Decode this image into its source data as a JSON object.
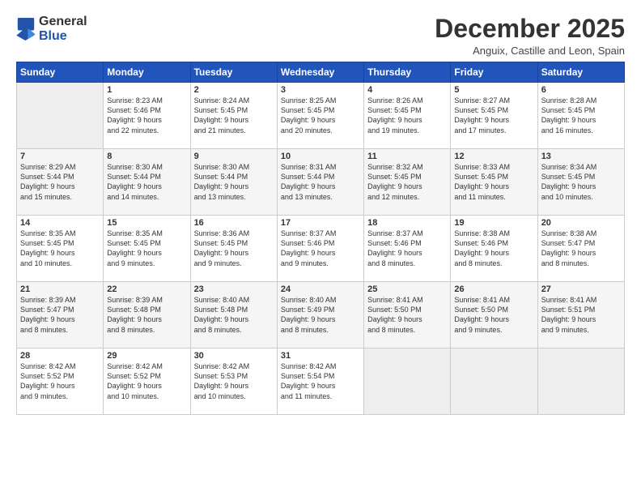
{
  "header": {
    "logo": {
      "general": "General",
      "blue": "Blue"
    },
    "title": "December 2025",
    "subtitle": "Anguix, Castille and Leon, Spain"
  },
  "weekdays": [
    "Sunday",
    "Monday",
    "Tuesday",
    "Wednesday",
    "Thursday",
    "Friday",
    "Saturday"
  ],
  "weeks": [
    [
      {
        "day": "",
        "info": ""
      },
      {
        "day": "1",
        "info": "Sunrise: 8:23 AM\nSunset: 5:46 PM\nDaylight: 9 hours\nand 22 minutes."
      },
      {
        "day": "2",
        "info": "Sunrise: 8:24 AM\nSunset: 5:45 PM\nDaylight: 9 hours\nand 21 minutes."
      },
      {
        "day": "3",
        "info": "Sunrise: 8:25 AM\nSunset: 5:45 PM\nDaylight: 9 hours\nand 20 minutes."
      },
      {
        "day": "4",
        "info": "Sunrise: 8:26 AM\nSunset: 5:45 PM\nDaylight: 9 hours\nand 19 minutes."
      },
      {
        "day": "5",
        "info": "Sunrise: 8:27 AM\nSunset: 5:45 PM\nDaylight: 9 hours\nand 17 minutes."
      },
      {
        "day": "6",
        "info": "Sunrise: 8:28 AM\nSunset: 5:45 PM\nDaylight: 9 hours\nand 16 minutes."
      }
    ],
    [
      {
        "day": "7",
        "info": "Sunrise: 8:29 AM\nSunset: 5:44 PM\nDaylight: 9 hours\nand 15 minutes."
      },
      {
        "day": "8",
        "info": "Sunrise: 8:30 AM\nSunset: 5:44 PM\nDaylight: 9 hours\nand 14 minutes."
      },
      {
        "day": "9",
        "info": "Sunrise: 8:30 AM\nSunset: 5:44 PM\nDaylight: 9 hours\nand 13 minutes."
      },
      {
        "day": "10",
        "info": "Sunrise: 8:31 AM\nSunset: 5:44 PM\nDaylight: 9 hours\nand 13 minutes."
      },
      {
        "day": "11",
        "info": "Sunrise: 8:32 AM\nSunset: 5:45 PM\nDaylight: 9 hours\nand 12 minutes."
      },
      {
        "day": "12",
        "info": "Sunrise: 8:33 AM\nSunset: 5:45 PM\nDaylight: 9 hours\nand 11 minutes."
      },
      {
        "day": "13",
        "info": "Sunrise: 8:34 AM\nSunset: 5:45 PM\nDaylight: 9 hours\nand 10 minutes."
      }
    ],
    [
      {
        "day": "14",
        "info": "Sunrise: 8:35 AM\nSunset: 5:45 PM\nDaylight: 9 hours\nand 10 minutes."
      },
      {
        "day": "15",
        "info": "Sunrise: 8:35 AM\nSunset: 5:45 PM\nDaylight: 9 hours\nand 9 minutes."
      },
      {
        "day": "16",
        "info": "Sunrise: 8:36 AM\nSunset: 5:45 PM\nDaylight: 9 hours\nand 9 minutes."
      },
      {
        "day": "17",
        "info": "Sunrise: 8:37 AM\nSunset: 5:46 PM\nDaylight: 9 hours\nand 9 minutes."
      },
      {
        "day": "18",
        "info": "Sunrise: 8:37 AM\nSunset: 5:46 PM\nDaylight: 9 hours\nand 8 minutes."
      },
      {
        "day": "19",
        "info": "Sunrise: 8:38 AM\nSunset: 5:46 PM\nDaylight: 9 hours\nand 8 minutes."
      },
      {
        "day": "20",
        "info": "Sunrise: 8:38 AM\nSunset: 5:47 PM\nDaylight: 9 hours\nand 8 minutes."
      }
    ],
    [
      {
        "day": "21",
        "info": "Sunrise: 8:39 AM\nSunset: 5:47 PM\nDaylight: 9 hours\nand 8 minutes."
      },
      {
        "day": "22",
        "info": "Sunrise: 8:39 AM\nSunset: 5:48 PM\nDaylight: 9 hours\nand 8 minutes."
      },
      {
        "day": "23",
        "info": "Sunrise: 8:40 AM\nSunset: 5:48 PM\nDaylight: 9 hours\nand 8 minutes."
      },
      {
        "day": "24",
        "info": "Sunrise: 8:40 AM\nSunset: 5:49 PM\nDaylight: 9 hours\nand 8 minutes."
      },
      {
        "day": "25",
        "info": "Sunrise: 8:41 AM\nSunset: 5:50 PM\nDaylight: 9 hours\nand 8 minutes."
      },
      {
        "day": "26",
        "info": "Sunrise: 8:41 AM\nSunset: 5:50 PM\nDaylight: 9 hours\nand 9 minutes."
      },
      {
        "day": "27",
        "info": "Sunrise: 8:41 AM\nSunset: 5:51 PM\nDaylight: 9 hours\nand 9 minutes."
      }
    ],
    [
      {
        "day": "28",
        "info": "Sunrise: 8:42 AM\nSunset: 5:52 PM\nDaylight: 9 hours\nand 9 minutes."
      },
      {
        "day": "29",
        "info": "Sunrise: 8:42 AM\nSunset: 5:52 PM\nDaylight: 9 hours\nand 10 minutes."
      },
      {
        "day": "30",
        "info": "Sunrise: 8:42 AM\nSunset: 5:53 PM\nDaylight: 9 hours\nand 10 minutes."
      },
      {
        "day": "31",
        "info": "Sunrise: 8:42 AM\nSunset: 5:54 PM\nDaylight: 9 hours\nand 11 minutes."
      },
      {
        "day": "",
        "info": ""
      },
      {
        "day": "",
        "info": ""
      },
      {
        "day": "",
        "info": ""
      }
    ]
  ]
}
